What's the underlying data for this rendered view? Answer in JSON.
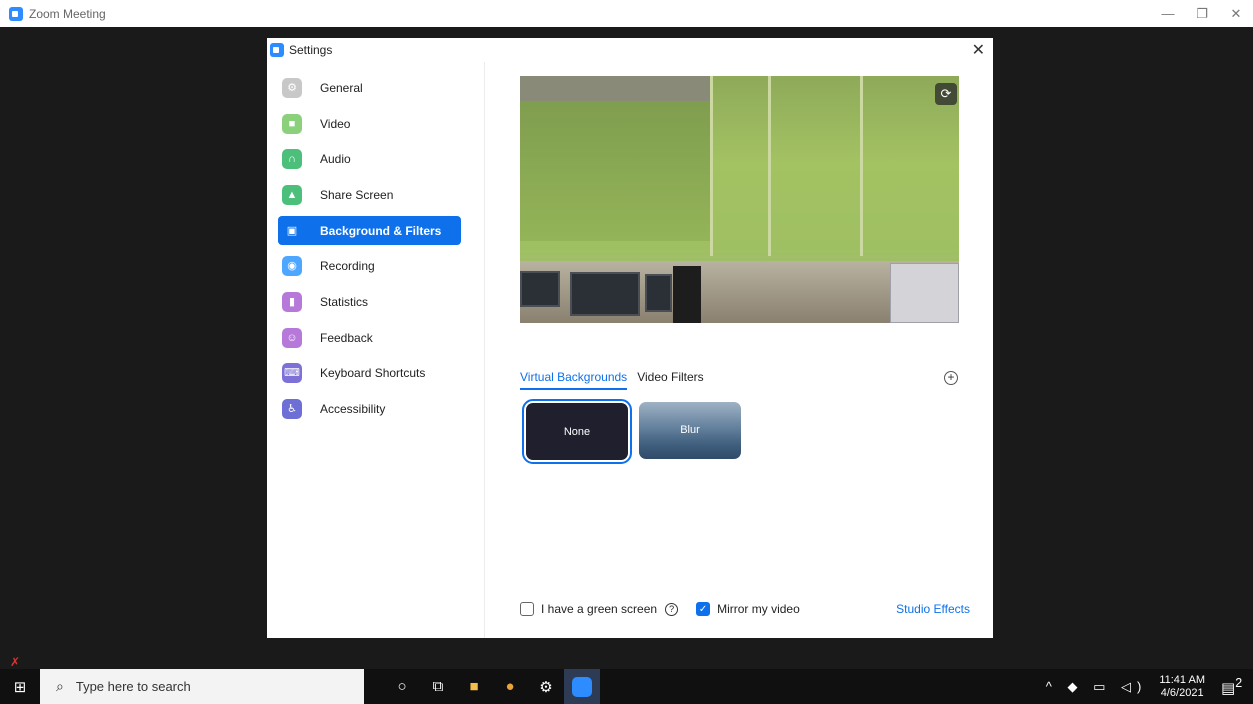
{
  "window": {
    "title": "Zoom Meeting",
    "controls": [
      "—",
      "❐",
      "✕"
    ]
  },
  "settings": {
    "title": "Settings",
    "close": "✕",
    "nav": [
      {
        "label": "General",
        "icon": "gear-icon",
        "color": "#b9b9b9",
        "glyph": "⚙"
      },
      {
        "label": "Video",
        "icon": "video-camera-icon",
        "color": "#8bd17c",
        "glyph": "■"
      },
      {
        "label": "Audio",
        "icon": "headphones-icon",
        "color": "#4cbf7a",
        "glyph": "∩"
      },
      {
        "label": "Share Screen",
        "icon": "share-screen-icon",
        "color": "#4cbf7a",
        "glyph": "▲"
      },
      {
        "label": "Background & Filters",
        "icon": "background-icon",
        "color": "#0e71eb",
        "glyph": "▣"
      },
      {
        "label": "Recording",
        "icon": "record-icon",
        "color": "#4da6ff",
        "glyph": "◉"
      },
      {
        "label": "Statistics",
        "icon": "statistics-icon",
        "color": "#b678d9",
        "glyph": "▮"
      },
      {
        "label": "Feedback",
        "icon": "feedback-icon",
        "color": "#b678d9",
        "glyph": "☺"
      },
      {
        "label": "Keyboard Shortcuts",
        "icon": "keyboard-icon",
        "color": "#7d71d8",
        "glyph": "⌨"
      },
      {
        "label": "Accessibility",
        "icon": "accessibility-icon",
        "color": "#6d6fd6",
        "glyph": "♿"
      }
    ],
    "active_index": 4
  },
  "main": {
    "tabs": [
      "Virtual Backgrounds",
      "Video Filters"
    ],
    "active_tab": 0,
    "add_button": "+",
    "backgrounds": [
      "None",
      "Blur"
    ],
    "selected_background": "None",
    "green_screen_label": "I have a green screen",
    "green_screen_checked": false,
    "help_glyph": "?",
    "mirror_label": "Mirror my video",
    "mirror_checked": true,
    "studio_effects": "Studio Effects"
  },
  "taskbar": {
    "search_placeholder": "Type here to search",
    "time": "11:41 AM",
    "date": "4/6/2021",
    "notification_count": "2"
  }
}
